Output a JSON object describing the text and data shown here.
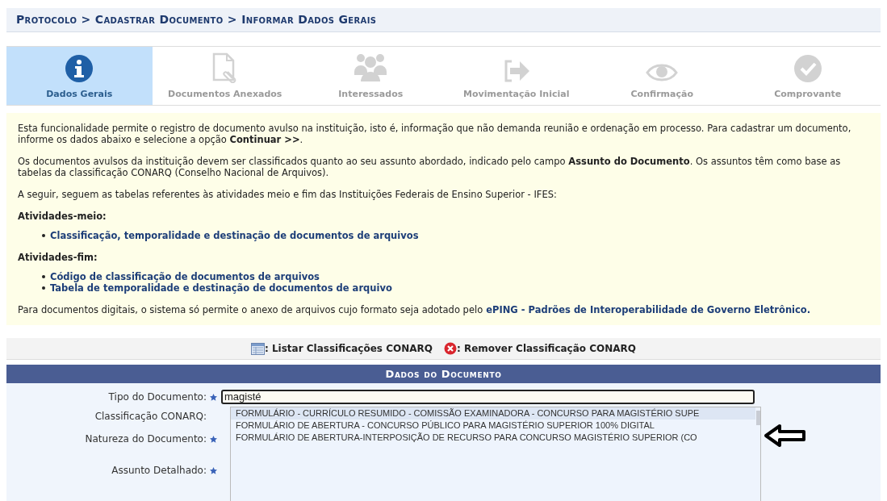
{
  "breadcrumb": "Protocolo > Cadastrar Documento > Informar Dados Gerais",
  "steps": [
    {
      "label": "Dados Gerais",
      "selected": true
    },
    {
      "label": "Documentos Anexados",
      "selected": false
    },
    {
      "label": "Interessados",
      "selected": false
    },
    {
      "label": "Movimentação Inicial",
      "selected": false
    },
    {
      "label": "Confirmação",
      "selected": false
    },
    {
      "label": "Comprovante",
      "selected": false
    }
  ],
  "info": {
    "paragraphs": [
      "Esta funcionalidade permite o registro de documento avulso na instituição, isto é, informação que não demanda reunião e ordenação em processo. Para cadastrar um documento, informe os dados abaixo e selecione a opção **Continuar >>**.",
      "Os documentos avulsos da instituição devem ser classificados quanto ao seu assunto abordado, indicado pelo campo **Assunto do Documento**. Os assuntos têm como base as tabelas da classificação CONARQ (Conselho Nacional de Arquivos).",
      "A seguir, seguem as tabelas referentes às atividades meio e fim das Instituições Federais de Ensino Superior - IFES:"
    ],
    "sections": [
      {
        "title": "Atividades-meio:",
        "links": [
          "Classificação, temporalidade e destinação de documentos de arquivos"
        ]
      },
      {
        "title": "Atividades-fim:",
        "links": [
          "Código de classificação de documentos de arquivos",
          "Tabela de temporalidade e destinação de documentos de arquivo"
        ]
      }
    ],
    "footer_text": "Para documentos digitais, o sistema só permite o anexo de arquivos cujo formato seja adotado pelo",
    "footer_link": "ePING - Padrões de Interoperabilidade de Governo Eletrônico."
  },
  "actions": [
    {
      "kind": "list",
      "label": ": Listar Classificações CONARQ"
    },
    {
      "kind": "remove",
      "label": ": Remover Classificação CONARQ"
    }
  ],
  "form": {
    "title": "Dados do Documento",
    "fields": [
      {
        "label": "Tipo do Documento:",
        "required": true,
        "value": "magisté"
      },
      {
        "label": "Classificação CONARQ:",
        "required": false
      },
      {
        "label": "Natureza do Documento:",
        "required": true
      },
      {
        "label": "Assunto Detalhado:",
        "required": true
      }
    ],
    "suggestions": [
      {
        "text": "FORMULÁRIO - CURRÍCULO RESUMIDO - COMISSÃO EXAMINADORA - CONCURSO PARA MAGISTÉRIO SUPE",
        "selected": true
      },
      {
        "text": "FORMULÁRIO DE ABERTURA - CONCURSO PÚBLICO PARA MAGISTÉRIO SUPERIOR 100% DIGITAL",
        "selected": false
      },
      {
        "text": "FORMULÁRIO DE ABERTURA-INTERPOSIÇÃO DE RECURSO PARA CONCURSO MAGISTÉRIO SUPERIOR (CO",
        "selected": false
      }
    ]
  }
}
